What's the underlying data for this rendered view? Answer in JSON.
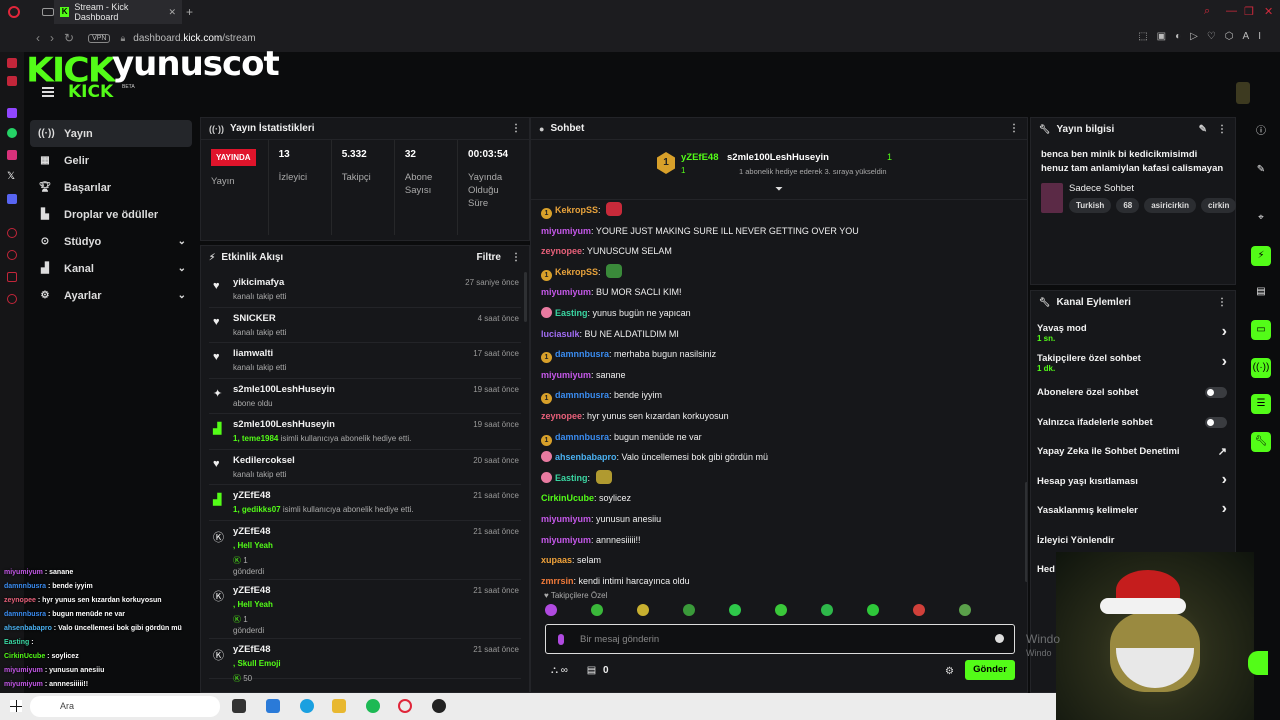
{
  "browser": {
    "tab_title": "Stream - Kick Dashboard",
    "vpn_label": "VPN",
    "url_prefix": "dashboard.",
    "url_domain": "kick.com",
    "url_path": "/stream",
    "ai_label": "AI"
  },
  "header": {
    "logo": "KICK",
    "channel_name": "yunuscot",
    "logo_small": "KICK",
    "beta": "BETA"
  },
  "leftnav": {
    "items": [
      {
        "label": "Yayın",
        "icon": "broadcast-icon"
      },
      {
        "label": "Gelir",
        "icon": "revenue-icon"
      },
      {
        "label": "Başarılar",
        "icon": "trophy-icon"
      },
      {
        "label": "Droplar ve ödüller",
        "icon": "gift-icon"
      },
      {
        "label": "Stüdyo",
        "icon": "studio-icon"
      },
      {
        "label": "Kanal",
        "icon": "channel-icon"
      },
      {
        "label": "Ayarlar",
        "icon": "settings-icon"
      }
    ]
  },
  "stats_panel": {
    "title": "Yayın İstatistikleri",
    "live_badge": "YAYINDA",
    "live_label": "Yayın",
    "viewers": "13",
    "viewers_label": "İzleyici",
    "followers": "5.332",
    "followers_label": "Takipçi",
    "subs": "32",
    "subs_label": "Abone Sayısı",
    "uptime": "00:03:54",
    "uptime_label": "Yayında Olduğu Süre"
  },
  "activity_panel": {
    "title": "Etkinlik Akışı",
    "filter": "Filtre",
    "items": [
      {
        "icon": "heart-icon",
        "name": "yikicimafya",
        "sub": "kanalı takip etti",
        "time": "27 saniye önce"
      },
      {
        "icon": "heart-icon",
        "name": "SNICKER",
        "sub": "kanalı takip etti",
        "time": "4 saat önce"
      },
      {
        "icon": "heart-icon",
        "name": "liamwalti",
        "sub": "kanalı takip etti",
        "time": "17 saat önce"
      },
      {
        "icon": "star-icon",
        "name": "s2mle100LeshHuseyin",
        "sub": "abone oldu",
        "time": "19 saat önce"
      },
      {
        "icon": "gift-icon",
        "name": "s2mle100LeshHuseyin",
        "sub_green": "1, teme1984",
        "sub": " isimli kullanıcıya abonelik hediye etti.",
        "time": "19 saat önce"
      },
      {
        "icon": "heart-icon",
        "name": "Kedilercoksel",
        "sub": "kanalı takip etti",
        "time": "20 saat önce"
      },
      {
        "icon": "gift-icon",
        "name": "yZEfE48",
        "sub_green": "1, gedikks07",
        "sub": " isimli kullanıcıya abonelik hediye etti.",
        "time": "21 saat önce"
      },
      {
        "icon": "kick-coin-icon",
        "name": "yZEfE48",
        "sub_green": ", Hell Yeah",
        "sub2": "1",
        "sub3": "gönderdi",
        "time": "21 saat önce"
      },
      {
        "icon": "kick-coin-icon",
        "name": "yZEfE48",
        "sub_green": ", Hell Yeah",
        "sub2": "1",
        "sub3": "gönderdi",
        "time": "21 saat önce"
      },
      {
        "icon": "kick-coin-icon",
        "name": "yZEfE48",
        "sub_green": ", Skull Emoji",
        "sub2": "50",
        "time": "21 saat önce"
      }
    ]
  },
  "chat_panel": {
    "title": "Sohbet",
    "pinned_user1": "yZEfE48",
    "pinned_count1": "1",
    "pinned_user2": "s2mle100LeshHuseyin",
    "pinned_count2": "1",
    "pinned_note": "1 abonelik hediye ederek 3. sıraya yükseldin",
    "messages": [
      {
        "user": "KekropSS",
        "color": "#e8a33c",
        "text": "",
        "badge": true
      },
      {
        "user": "miyumiyum",
        "color": "#c458e8",
        "text": "YOURE JUST MAKING SURE ILL NEVER GETTING OVER YOU"
      },
      {
        "user": "zeynopee",
        "color": "#e8607a",
        "text": "YUNUSCUM SELAM"
      },
      {
        "user": "KekropSS",
        "color": "#e8a33c",
        "text": "",
        "badge": true
      },
      {
        "user": "miyumiyum",
        "color": "#c458e8",
        "text": "BU MOR SACLI KIM!"
      },
      {
        "user": "Easting",
        "color": "#3ad6a2",
        "text": "yunus bugün ne yapıcan"
      },
      {
        "user": "luciasulk",
        "color": "#a06cf2",
        "text": "BU NE ALDATILDIM MI"
      },
      {
        "user": "damnnbusra",
        "color": "#3a8cf0",
        "text": "merhaba bugun nasilsiniz"
      },
      {
        "user": "miyumiyum",
        "color": "#c458e8",
        "text": "sanane"
      },
      {
        "user": "damnnbusra",
        "color": "#3a8cf0",
        "text": "bende iyyim"
      },
      {
        "user": "zeynopee",
        "color": "#e8607a",
        "text": "hyr yunus sen kızardan korkuyosun"
      },
      {
        "user": "damnnbusra",
        "color": "#3a8cf0",
        "text": "bugun menüde ne var"
      },
      {
        "user": "ahsenbabapro",
        "color": "#4ab0f0",
        "text": "Valo üncellemesi bok gibi gördün mü"
      },
      {
        "user": "Easting",
        "color": "#3ad6a2",
        "text": ""
      },
      {
        "user": "CirkinUcube",
        "color": "#53fc18",
        "text": "soylicez"
      },
      {
        "user": "miyumiyum",
        "color": "#c458e8",
        "text": "yunusun anesiiu"
      },
      {
        "user": "miyumiyum",
        "color": "#c458e8",
        "text": "annnesiiiii!!"
      },
      {
        "user": "xupaas",
        "color": "#f0a23a",
        "text": "selam"
      },
      {
        "user": "zmrrsin",
        "color": "#f07a3a",
        "text": "kendi intimi harcayınca oldu"
      }
    ],
    "subonly": "Takipçilere Özel",
    "input_placeholder": "Bir mesaj gönderin",
    "send": "Gönder",
    "points": "0"
  },
  "info_panel": {
    "title": "Yayın bilgisi",
    "stream_title": "benca ben minik bi kedicikmisimdi henuz tam anlamiylan kafasi calismayan",
    "category": "Sadece Sohbet",
    "tags": [
      "Turkish",
      "68",
      "asiricirkin",
      "cirkin"
    ]
  },
  "actions_panel": {
    "title": "Kanal Eylemleri",
    "items": [
      {
        "label": "Yavaş mod",
        "sub": "1 sn.",
        "type": "chevron"
      },
      {
        "label": "Takipçilere özel sohbet",
        "sub": "1 dk.",
        "type": "chevron"
      },
      {
        "label": "Abonelere özel sohbet",
        "type": "toggle"
      },
      {
        "label": "Yalnızca ifadelerle sohbet",
        "type": "toggle"
      },
      {
        "label": "Yapay Zeka ile Sohbet Denetimi",
        "type": "external"
      },
      {
        "label": "Hesap yaşı kısıtlaması",
        "type": "chevron"
      },
      {
        "label": "Yasaklanmış kelimeler",
        "type": "chevron"
      },
      {
        "label": "İzleyici Yönlendir",
        "type": "none"
      },
      {
        "label": "Hed",
        "type": "none"
      }
    ]
  },
  "overlay_chat": [
    {
      "user": "miyumiyum",
      "color": "#c458e8",
      "text": " : sanane"
    },
    {
      "user": "damnnbusra",
      "color": "#3a8cf0",
      "text": " : bende iyyim"
    },
    {
      "user": "zeynopee",
      "color": "#e8607a",
      "text": " : hyr yunus sen kızardan korkuyosun"
    },
    {
      "user": "damnnbusra",
      "color": "#3a8cf0",
      "text": " : bugun menüde ne var"
    },
    {
      "user": "ahsenbabapro",
      "color": "#4ab0f0",
      "text": " : Valo üncellemesi bok gibi gördün mü"
    },
    {
      "user": "Easting",
      "color": "#3ad6a2",
      "text": " :"
    },
    {
      "user": "CirkinUcube",
      "color": "#53fc18",
      "text": " : soylicez"
    },
    {
      "user": "miyumiyum",
      "color": "#c458e8",
      "text": " : yunusun anesiiu"
    },
    {
      "user": "miyumiyum",
      "color": "#c458e8",
      "text": " : annnesiiiii!!"
    }
  ],
  "watermark": {
    "line1": "Windo",
    "line2": "Windo"
  },
  "taskbar": {
    "search": "Ara"
  }
}
